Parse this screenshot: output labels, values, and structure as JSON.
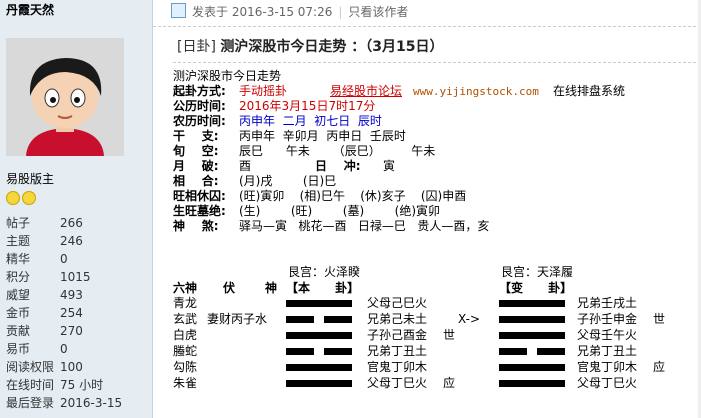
{
  "sidebar": {
    "username": "丹霞天然",
    "rank": "易股版主",
    "stats": [
      {
        "k": "帖子",
        "v": "266"
      },
      {
        "k": "主题",
        "v": "246"
      },
      {
        "k": "精华",
        "v": "0"
      },
      {
        "k": "积分",
        "v": "1015"
      },
      {
        "k": "威望",
        "v": "493"
      },
      {
        "k": "金币",
        "v": "254"
      },
      {
        "k": "贡献",
        "v": "270"
      },
      {
        "k": "易币",
        "v": "0"
      },
      {
        "k": "阅读权限",
        "v": "100"
      },
      {
        "k": "在线时间",
        "v": "75 小时"
      },
      {
        "k": "最后登录",
        "v": "2016-3-15"
      }
    ]
  },
  "post": {
    "posted_label": "发表于",
    "posted_time": "2016-3-15 07:26",
    "author_only": "只看该作者",
    "title_tag": "[日卦]",
    "title_text": "测沪深股市今日走势 ：（3月15日）"
  },
  "content": {
    "line0": "测沪深股市今日走势",
    "qigua_label": "起卦方式:",
    "qigua_value": "手动摇卦",
    "forum_text": "易经股市论坛",
    "site_url": "www.yijingstock.com",
    "site_tail": "在线排盘系统",
    "gongli_label": "公历时间:",
    "gongli_value": "2016年3月15日7时17分",
    "nongli_label": "农历时间:",
    "nongli_value": "丙申年  二月  初七日  辰时",
    "gan_label": "干    支:",
    "gan_value": "丙申年  辛卯月  丙申日  壬辰时",
    "xun_label": "旬    空:",
    "xun_value": "辰巳      午未      （辰巳）        午未",
    "yue_label": "月    破:",
    "yue_value": "酉",
    "ri_label": "日    冲:",
    "ri_value": "寅",
    "xiang_label": "相    合:",
    "xiang_value": "(月)戌        (日)巳",
    "wang_label": "旺相休囚:",
    "wang_value": "(旺)寅卯    (相)巳午    (休)亥子    (囚)申酉",
    "sheng_label": "生旺墓绝:",
    "sheng_value": "(生)        (旺)        (墓)        (绝)寅卯",
    "shen_label": "神    煞:",
    "shen_value": "驿马—寅   桃花—酉   日禄—巳   贵人—酉，亥"
  },
  "hexagram": {
    "gong_left": "艮宫：火泽睽",
    "gong_right": "艮宫：天泽履",
    "head_liushen": "六神",
    "head_fu": "伏",
    "head_shen": "神",
    "head_ben": "【本      卦】",
    "head_bian": "【变      卦】",
    "arrow": "X->",
    "rows": [
      {
        "liushen": "青龙",
        "fushen": "",
        "ben": "父母己巳火",
        "shi": "",
        "bian": "兄弟壬戌土",
        "bshi": "",
        "ben_type": "yang",
        "bian_type": "yang"
      },
      {
        "liushen": "玄武",
        "fushen": "妻财丙子水",
        "ben": "兄弟己未土",
        "shi": "",
        "bian": "子孙壬申金",
        "bshi": "世",
        "ben_type": "yin",
        "bian_type": "yang"
      },
      {
        "liushen": "白虎",
        "fushen": "",
        "ben": "子孙己酉金",
        "shi": "世",
        "bian": "父母壬午火",
        "bshi": "",
        "ben_type": "yang",
        "bian_type": "yang"
      },
      {
        "liushen": "螣蛇",
        "fushen": "",
        "ben": "兄弟丁丑土",
        "shi": "",
        "bian": "兄弟丁丑土",
        "bshi": "",
        "ben_type": "yin",
        "bian_type": "yin"
      },
      {
        "liushen": "勾陈",
        "fushen": "",
        "ben": "官鬼丁卯木",
        "shi": "",
        "bian": "官鬼丁卯木",
        "bshi": "应",
        "ben_type": "yang",
        "bian_type": "yang"
      },
      {
        "liushen": "朱雀",
        "fushen": "",
        "ben": "父母丁巳火",
        "shi": "应",
        "bian": "父母丁巳火",
        "bshi": "",
        "ben_type": "yang",
        "bian_type": "yang"
      }
    ]
  }
}
